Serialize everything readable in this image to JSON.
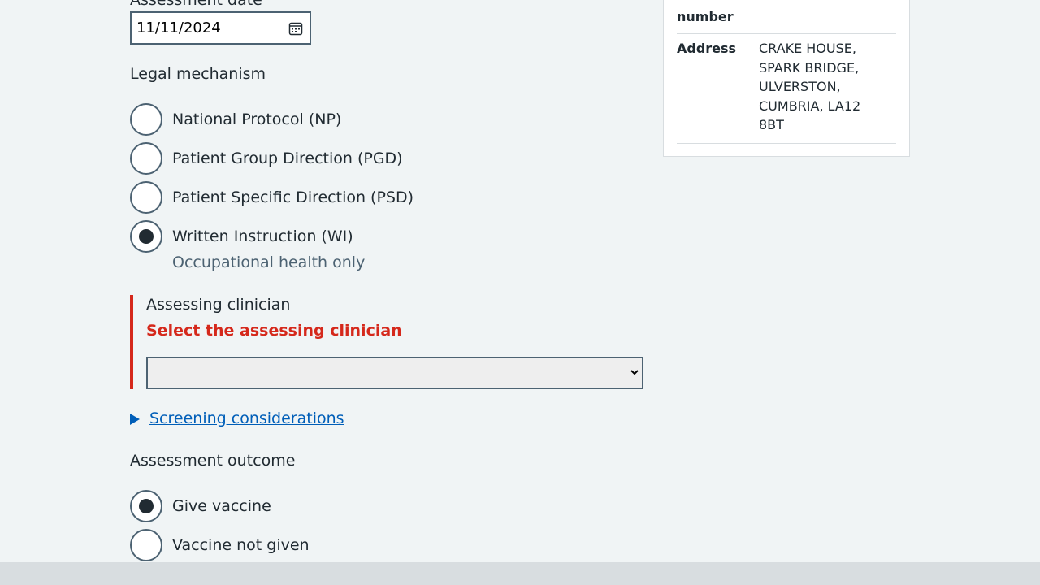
{
  "assessment_date": {
    "label": "Assessment date",
    "value": "11/11/2024",
    "icon": "calendar-icon"
  },
  "legal_mechanism": {
    "label": "Legal mechanism",
    "options": [
      {
        "label": "National Protocol (NP)",
        "checked": false
      },
      {
        "label": "Patient Group Direction (PGD)",
        "checked": false
      },
      {
        "label": "Patient Specific Direction (PSD)",
        "checked": false
      },
      {
        "label": "Written Instruction (WI)",
        "checked": true,
        "hint": "Occupational health only"
      }
    ]
  },
  "assessing_clinician": {
    "label": "Assessing clinician",
    "error": "Select the assessing clinician",
    "selected": ""
  },
  "details": {
    "summary": "Screening considerations"
  },
  "assessment_outcome": {
    "label": "Assessment outcome",
    "options": [
      {
        "label": "Give vaccine",
        "checked": true
      },
      {
        "label": "Vaccine not given",
        "checked": false
      }
    ]
  },
  "patient_card": {
    "number_key": "number",
    "address_key": "Address",
    "address_lines": [
      "CRAKE HOUSE,",
      "SPARK BRIDGE,",
      "ULVERSTON,",
      "CUMBRIA, LA12",
      "8BT"
    ]
  },
  "colors": {
    "error": "#d5281b",
    "link": "#005eb8",
    "text": "#212b32",
    "hint": "#4c6272",
    "background": "#f0f4f5"
  }
}
